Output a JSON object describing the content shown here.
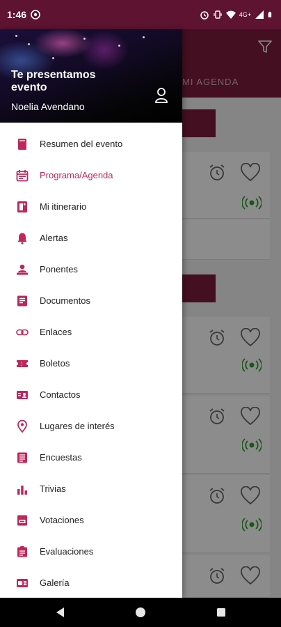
{
  "status_bar": {
    "time": "1:46",
    "network_label": "4G+",
    "icons": [
      "whatsapp-icon",
      "alarm-icon",
      "vibrate-icon",
      "wifi-icon",
      "signal-icon",
      "battery-icon"
    ]
  },
  "background": {
    "tab_agenda": "MI AGENDA"
  },
  "drawer": {
    "header_title": "Te presentamos evento",
    "user_name": "Noelia Avendano",
    "active_item": "Programa/Agenda",
    "items": [
      {
        "label": "Resumen del evento",
        "icon": "book-icon"
      },
      {
        "label": "Programa/Agenda",
        "icon": "calendar-icon"
      },
      {
        "label": "Mi itinerario",
        "icon": "itinerary-icon"
      },
      {
        "label": "Alertas",
        "icon": "bell-icon"
      },
      {
        "label": "Ponentes",
        "icon": "speaker-icon"
      },
      {
        "label": "Documentos",
        "icon": "document-icon"
      },
      {
        "label": "Enlaces",
        "icon": "link-icon"
      },
      {
        "label": "Boletos",
        "icon": "ticket-icon"
      },
      {
        "label": "Contactos",
        "icon": "contact-card-icon"
      },
      {
        "label": "Lugares de interés",
        "icon": "location-pin-icon"
      },
      {
        "label": "Encuestas",
        "icon": "survey-icon"
      },
      {
        "label": "Trivias",
        "icon": "trivia-icon"
      },
      {
        "label": "Votaciones",
        "icon": "vote-icon"
      },
      {
        "label": "Evaluaciones",
        "icon": "evaluation-icon"
      },
      {
        "label": "Galería",
        "icon": "gallery-icon"
      }
    ]
  },
  "colors": {
    "brand": "#7b1d3d",
    "status_bar": "#5e1430",
    "accent": "#c0275a",
    "live": "#2e9e2e"
  }
}
